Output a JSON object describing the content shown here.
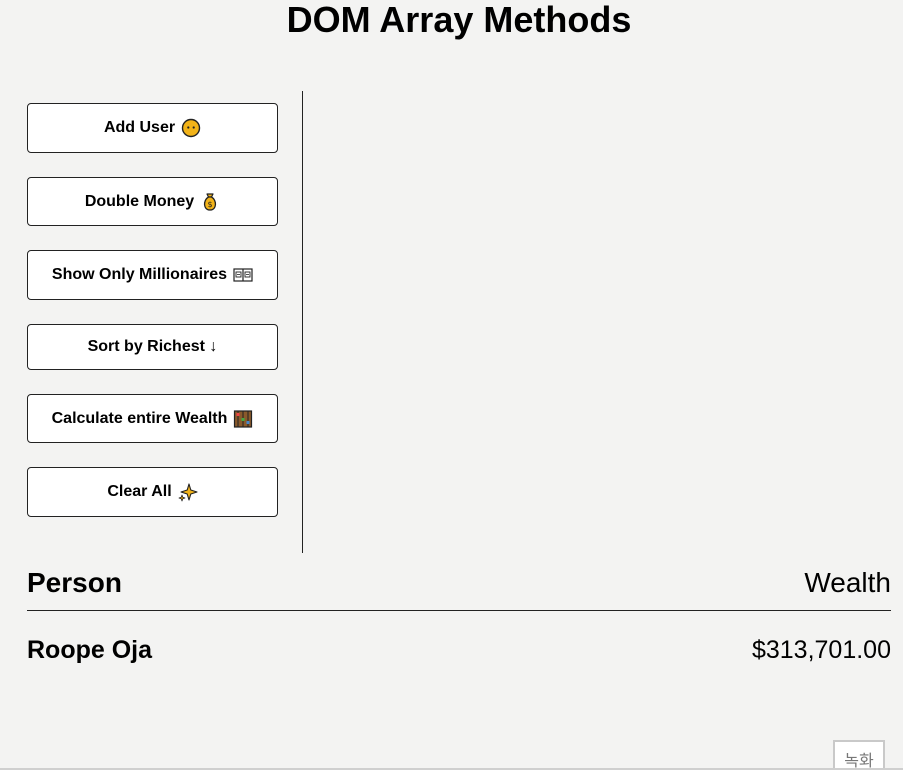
{
  "page": {
    "title": "DOM Array Methods"
  },
  "sidebar": {
    "buttons": [
      {
        "label": "Add User",
        "icon": "face-icon"
      },
      {
        "label": "Double Money",
        "icon": "money-bag-icon"
      },
      {
        "label": "Show Only Millionaires",
        "icon": "ledger-icon"
      },
      {
        "label": "Sort by Richest ↓",
        "icon": ""
      },
      {
        "label": "Calculate entire Wealth",
        "icon": "abacus-icon"
      },
      {
        "label": "Clear All",
        "icon": "sparkles-icon"
      }
    ]
  },
  "table": {
    "headers": {
      "person": "Person",
      "wealth": "Wealth"
    },
    "rows": [
      {
        "name": "Roope Oja",
        "wealth": "$313,701.00"
      }
    ]
  },
  "overlay": {
    "corner_badge": "녹화"
  },
  "colors": {
    "background": "#f3f3f2",
    "button_bg": "#ffffff",
    "border": "#222222",
    "emoji_yellow": "#f2b318"
  }
}
